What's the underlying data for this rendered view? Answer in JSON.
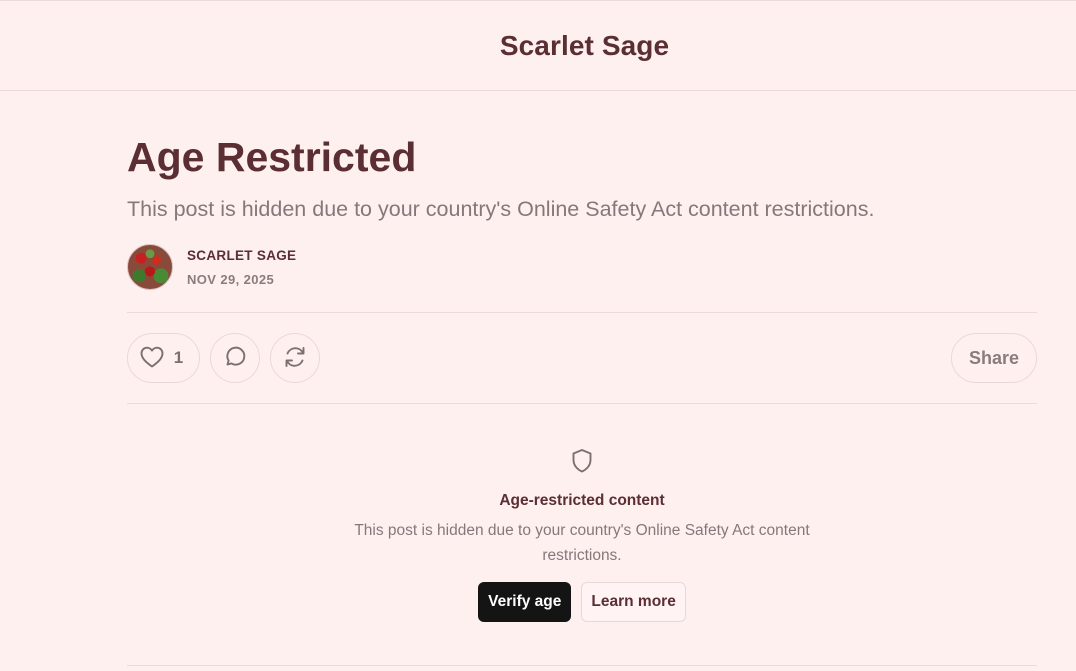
{
  "site": {
    "title": "Scarlet Sage"
  },
  "post": {
    "title": "Age Restricted",
    "subtitle": "This post is hidden due to your country's Online Safety Act content restrictions.",
    "author": "SCARLET SAGE",
    "date": "NOV 29, 2025"
  },
  "actions": {
    "like_count": "1",
    "share_label": "Share",
    "icons": {
      "like": "heart-icon",
      "comment": "comment-icon",
      "restack": "restack-icon"
    }
  },
  "restriction": {
    "icon": "shield-icon",
    "heading": "Age-restricted content",
    "body": "This post is hidden due to your country's Online Safety Act content restrictions.",
    "verify_label": "Verify age",
    "learn_label": "Learn more"
  },
  "colors": {
    "background": "#fff0f0",
    "brand_text": "#5a2e33",
    "muted_text": "#85787a",
    "primary_button": "#141414"
  }
}
